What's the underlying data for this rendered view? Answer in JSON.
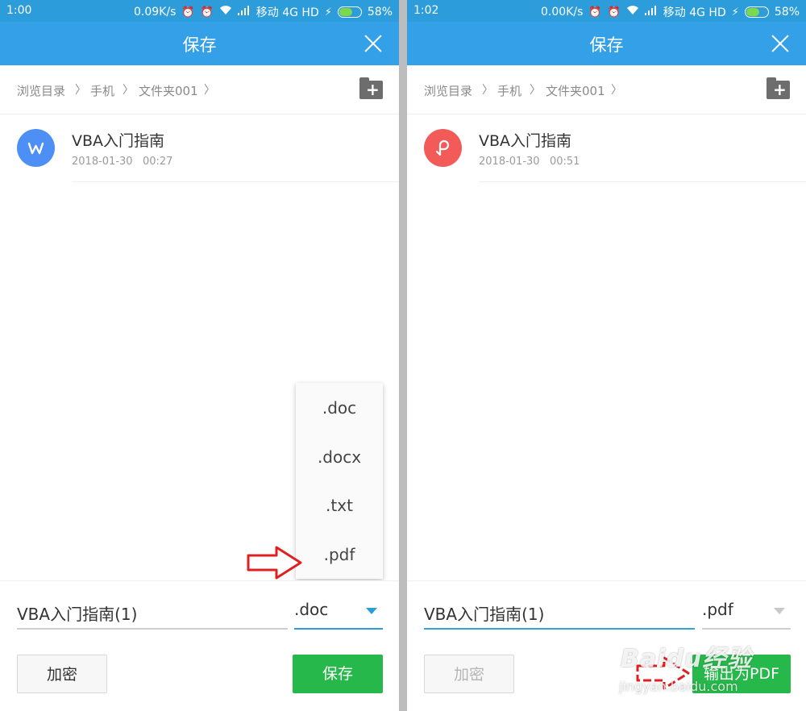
{
  "left": {
    "status_time": "1:00",
    "status_speed": "0.09K/s",
    "status_carrier": "移动 4G HD",
    "status_battery": "58%",
    "title": "保存",
    "breadcrumb": [
      "浏览目录",
      "手机",
      "文件夹001"
    ],
    "file": {
      "name": "VBA入门指南",
      "date": "2018-01-30",
      "time": "00:27",
      "icon": "word-icon"
    },
    "dropdown_options": [
      ".doc",
      ".docx",
      ".txt",
      ".pdf"
    ],
    "filename_value": "VBA入门指南(1)",
    "selected_ext": ".doc",
    "encrypt_label": "加密",
    "save_label": "保存"
  },
  "right": {
    "status_time": "1:02",
    "status_speed": "0.00K/s",
    "status_carrier": "移动 4G HD",
    "status_battery": "58%",
    "title": "保存",
    "breadcrumb": [
      "浏览目录",
      "手机",
      "文件夹001"
    ],
    "file": {
      "name": "VBA入门指南",
      "date": "2018-01-30",
      "time": "00:51",
      "icon": "pdf-icon"
    },
    "filename_value": "VBA入门指南(1)",
    "selected_ext": ".pdf",
    "encrypt_label": "加密",
    "export_label": "输出为PDF"
  },
  "watermark": {
    "brand": "Baidu经验",
    "url": "jingyan.baidu.com"
  },
  "colors": {
    "statusbar": "#2d9cdb",
    "titlebar": "#34a0e7",
    "accent": "#2d9cdb",
    "primary_button": "#27b84c",
    "word_icon": "#4d8ff5",
    "pdf_icon": "#f25b57",
    "annotation_arrow": "#e02020"
  }
}
